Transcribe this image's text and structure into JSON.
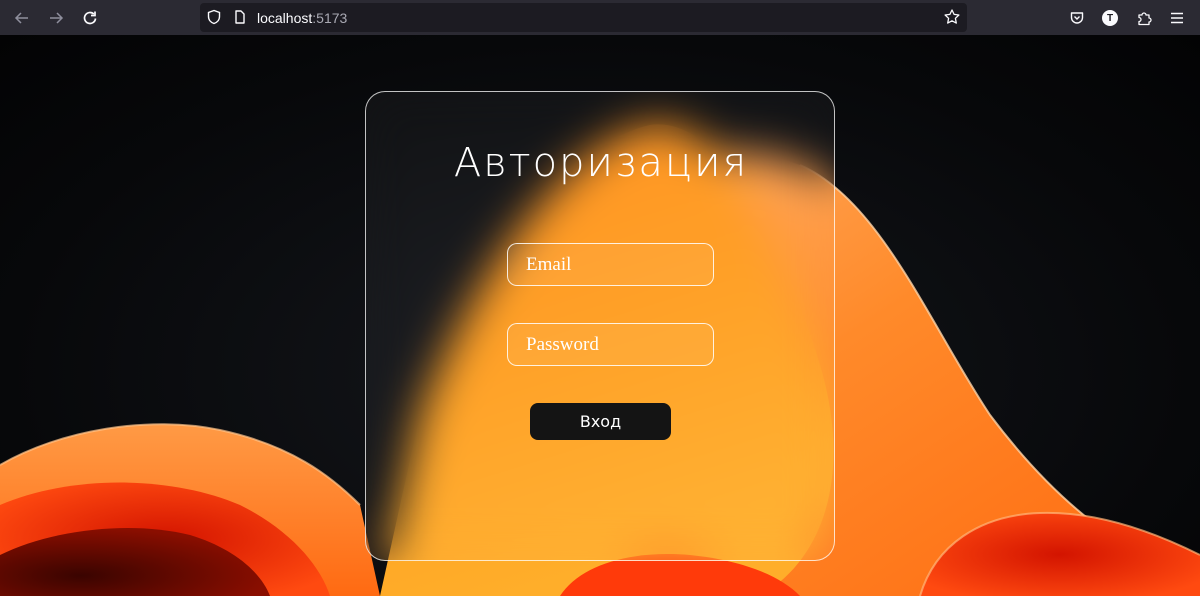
{
  "browser": {
    "url_host": "localhost",
    "url_port": ":5173",
    "account_initial": "T"
  },
  "icons": {
    "back": "back-arrow-icon",
    "forward": "forward-arrow-icon",
    "reload": "reload-icon",
    "shield": "tracking-protection-shield-icon",
    "page": "page-info-icon",
    "bookmark": "bookmark-star-icon",
    "pocket": "pocket-icon",
    "extensions": "extensions-puzzle-icon",
    "menu": "hamburger-menu-icon"
  },
  "login": {
    "title": "Авторизация",
    "email_placeholder": "Email",
    "password_placeholder": "Password",
    "submit_label": "Вход"
  },
  "colors": {
    "chrome_bg": "#2b2a33",
    "page_bg": "#07080a",
    "accent_orange": "#ff8a1e",
    "button_bg": "#141414"
  }
}
